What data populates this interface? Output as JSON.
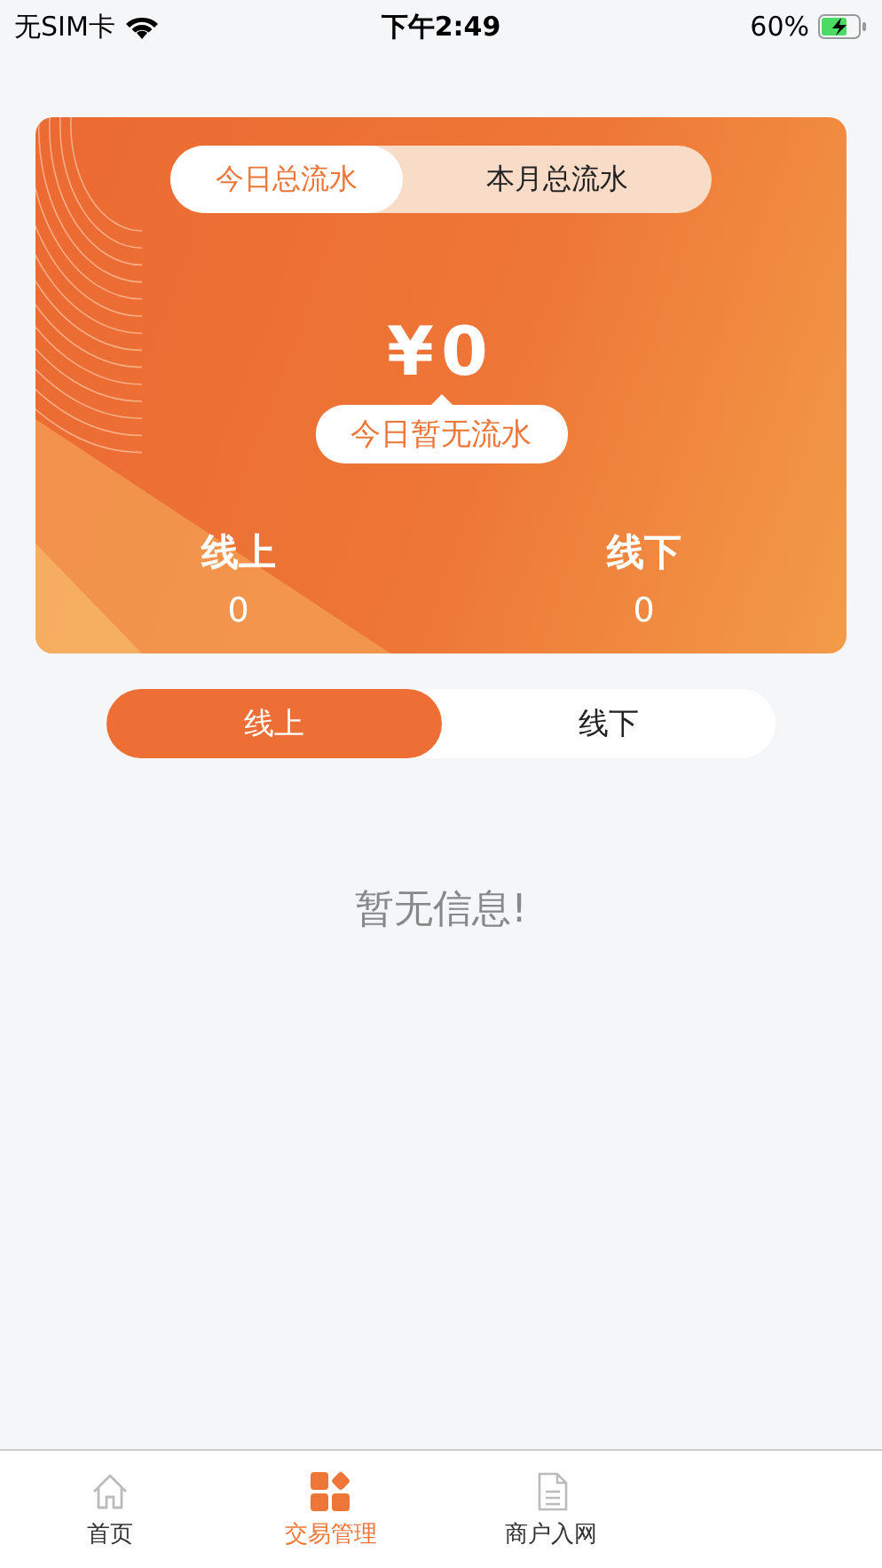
{
  "status_bar": {
    "carrier": "无SIM卡",
    "time": "下午2:49",
    "battery": "60%"
  },
  "summary_card": {
    "tabs": [
      {
        "label": "今日总流水",
        "selected": true
      },
      {
        "label": "本月总流水",
        "selected": false
      }
    ],
    "amount": "¥0",
    "note": "今日暂无流水",
    "stats": [
      {
        "label": "线上",
        "value": "0"
      },
      {
        "label": "线下",
        "value": "0"
      }
    ]
  },
  "channel_tabs": [
    {
      "label": "线上",
      "selected": true
    },
    {
      "label": "线下",
      "selected": false
    }
  ],
  "empty_message": "暂无信息!",
  "tab_bar": [
    {
      "label": "首页",
      "selected": false
    },
    {
      "label": "交易管理",
      "selected": true
    },
    {
      "label": "商户入网",
      "selected": false
    }
  ]
}
